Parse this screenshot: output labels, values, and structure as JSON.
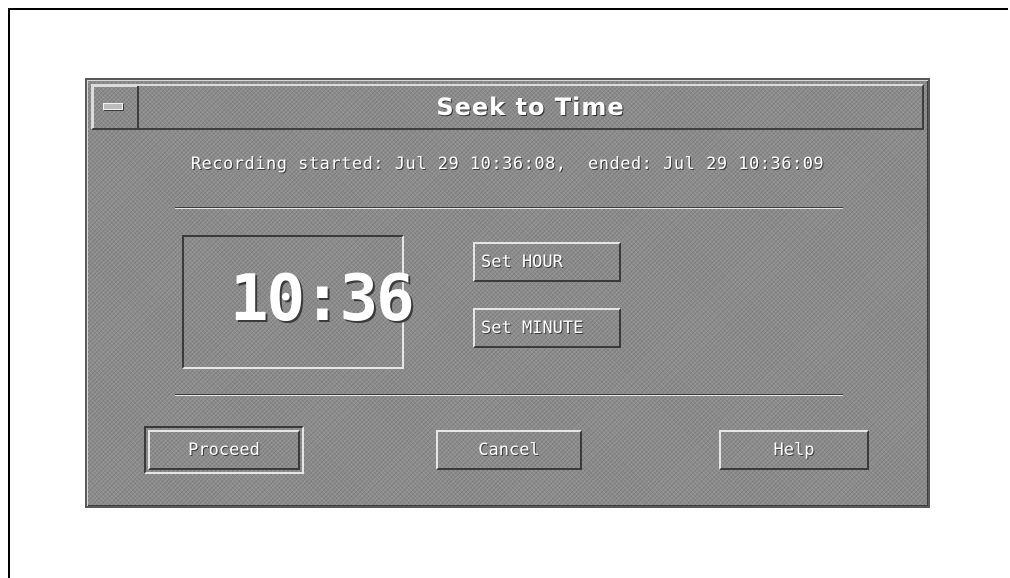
{
  "dialog": {
    "title": "Seek to Time",
    "info": "Recording started: Jul 29 10:36:08,  ended: Jul 29 10:36:09",
    "clock": {
      "display": "10:36"
    },
    "buttons": {
      "set_hour": "Set HOUR",
      "set_minute": "Set MINUTE",
      "proceed": "Proceed",
      "cancel": "Cancel",
      "help": "Help"
    }
  },
  "colors": {
    "dialog_bg": "#8c8c8c",
    "text": "#ffffff",
    "highlight": "#e6e6e6",
    "shadow": "#3a3a3a"
  }
}
